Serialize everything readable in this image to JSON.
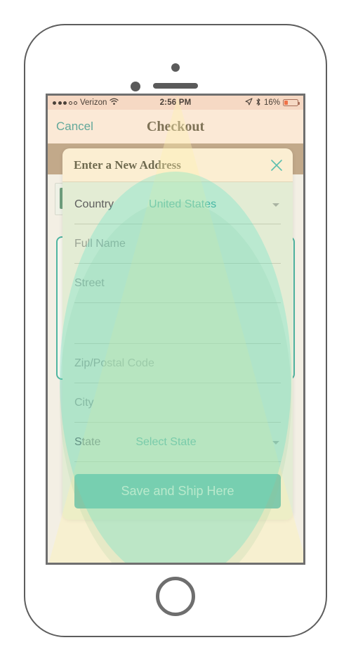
{
  "status_bar": {
    "signal_dots_filled": 3,
    "signal_dots_total": 5,
    "carrier": "Verizon",
    "wifi_icon": "wifi-icon",
    "time": "2:56 PM",
    "location_icon": "location-arrow-icon",
    "bluetooth_icon": "bluetooth-icon",
    "battery_percent": "16%",
    "battery_icon": "battery-low-icon"
  },
  "nav_bar": {
    "cancel_label": "Cancel",
    "title": "Checkout"
  },
  "checkout_progress": {
    "step_count": 3,
    "active_step": 1
  },
  "modal": {
    "title": "Enter a New Address",
    "close_icon": "close-x-icon",
    "fields": [
      {
        "type": "select",
        "label": "Country",
        "value": "United States",
        "caret_icon": "chevron-down-icon"
      },
      {
        "type": "text",
        "placeholder": "Full Name",
        "value": ""
      },
      {
        "type": "text",
        "placeholder": "Street",
        "value": ""
      },
      {
        "type": "text",
        "placeholder": "",
        "value": ""
      },
      {
        "type": "text",
        "placeholder": "Zip/Postal Code",
        "value": ""
      },
      {
        "type": "text",
        "placeholder": "City",
        "value": ""
      },
      {
        "type": "select",
        "label": "State",
        "value": "Select State",
        "caret_icon": "chevron-down-icon"
      }
    ],
    "submit_label": "Save and Ship Here"
  },
  "colors": {
    "accent_teal": "#34b1a8",
    "link_teal": "#3ba596",
    "nav_bg": "#fbe9d6",
    "status_bg": "#f6d9c4",
    "modal_header_bg": "#fbeed2",
    "modal_body_bg": "#e3ecd4",
    "battery_fill": "#ef7248",
    "title_brown": "#7e7256"
  }
}
